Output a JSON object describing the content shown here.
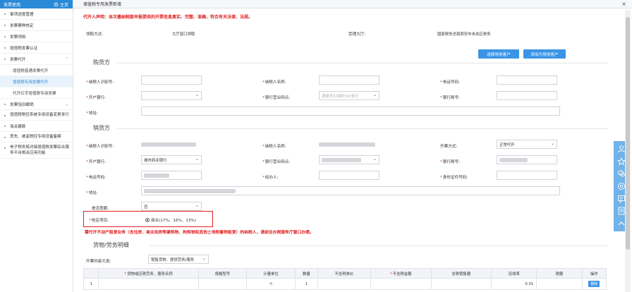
{
  "sidebar": {
    "header_title": "发票使用",
    "home_label": "主页",
    "items": [
      {
        "label": "事项进度管理"
      },
      {
        "label": "发票票种核定"
      },
      {
        "label": "发票领用"
      },
      {
        "label": "增值税发票认证"
      },
      {
        "label": "发票代开"
      },
      {
        "label": "发票验旧缴销"
      },
      {
        "label": "增值税税控系统专用设备变更发行"
      },
      {
        "label": "海关缴款"
      },
      {
        "label": "丢失、被盗税控专用设备备案"
      },
      {
        "label": "电子税务局对接增值税发票综合服务平台相关应用功能"
      }
    ],
    "subitems": [
      {
        "label": "增值税普通发票代开"
      },
      {
        "label": "增值税专用发票代开"
      },
      {
        "label": "代开红字增值税专用发票"
      }
    ]
  },
  "header": {
    "title": "增值税专用发票新增",
    "close": "×"
  },
  "declaration": "代开人声明：本次缴纳税款申报提供的开票信息真实、完整、准确，符合有关法律、法规。",
  "general": {
    "pickup_label": "领取方式:",
    "pickup_value": "大厅窗口领取",
    "hall_label": "受理大厅:",
    "hall_value": "国家税务总局西安市未央区税务"
  },
  "buttons": {
    "select_customer": "选择常用客户",
    "add_customer": "添加为常用客户",
    "delete": "删除"
  },
  "buyer": {
    "title": "购货方",
    "taxpayer_id_label": "纳税人识别号:",
    "taxpayer_name_label": "纳税人名称:",
    "phone_label": "电话号码:",
    "bank_label": "开户银行:",
    "bank_outlet_label": "银行营业网点:",
    "bank_outlet_placeholder": "请填写XX银行XX支行",
    "bank_account_label": "银行账号:",
    "address_label": "地址:"
  },
  "seller": {
    "title": "销货方",
    "taxpayer_id_label": "纳税人识别号:",
    "taxpayer_name_label": "纳税人名称:",
    "invoice_mode_label": "开票方式:",
    "invoice_mode_value": "正常代开",
    "bank_label": "开户银行:",
    "bank_value": "城市商业银行",
    "bank_outlet_label": "银行营业网点:",
    "bank_account_label": "银行账号:",
    "phone_label": "电话号码:",
    "agent_label": "经办人:",
    "id_no_label": "身份证件号码:",
    "address_label": "地址:",
    "deduction_label": "是否差额:",
    "deduction_value": "否",
    "levy_label": "核定项目:",
    "levy_value": "商业(17%、16%、13%)"
  },
  "warning": "需代开不动产租赁业务（含住房、商业用房等建筑物、构筑物和其他土地附着物租赁）的纳税人，请前往办税服务厅窗口办理。",
  "goods": {
    "title": "货物/劳务明细",
    "category_label": "开票内容大类:",
    "category_value": "销售货物、提供劳务/服务",
    "columns": [
      "货物或应税劳务、服务名称",
      "规格型号",
      "计量单位",
      "数量",
      "不含税单价",
      "不含税金额",
      "含税销售额",
      "征收率",
      "税额",
      "操作"
    ],
    "rows": [
      {
        "index": "1",
        "unit": "个",
        "quantity": "1",
        "rate": "0.01"
      }
    ]
  }
}
